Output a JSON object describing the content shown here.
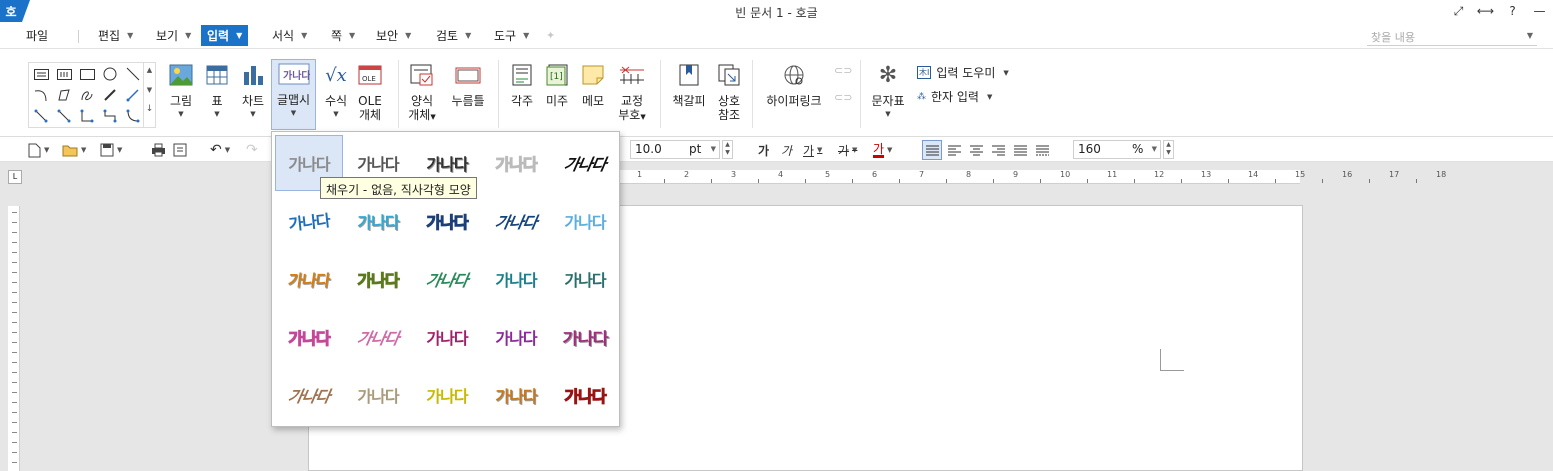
{
  "title": "빈 문서 1 - 호글",
  "app_logo": "호",
  "window_controls": [
    "⤢",
    "⟷",
    "?",
    "—"
  ],
  "menu": {
    "file": "파일",
    "items": [
      "편집",
      "보기",
      "입력",
      "서식",
      "쪽",
      "보안",
      "검토",
      "도구"
    ],
    "active": "입력",
    "search_placeholder": "찾을 내용"
  },
  "ribbon": {
    "picture": "그림",
    "table": "표",
    "chart": "차트",
    "wordart": "글맵시",
    "formula": "수식",
    "ole_line1": "OLE",
    "ole_line2": "개체",
    "form_line1": "양식",
    "form_line2": "개체",
    "pushbutton": "누름틀",
    "footnote": "각주",
    "endnote": "미주",
    "memo": "메모",
    "proof_line1": "교정",
    "proof_line2": "부호",
    "bookmark": "책갈피",
    "crossref_line1": "상호",
    "crossref_line2": "참조",
    "hyperlink": "하이퍼링크",
    "charmap": "문자표",
    "input_helper": "입력 도우미",
    "hanja_input": "한자 입력"
  },
  "toolbar": {
    "font_size": "10.0",
    "font_unit": "pt",
    "bold": "가",
    "italic": "가",
    "underline": "가",
    "strike": "가",
    "color_text": "가",
    "zoom": "160",
    "zoom_unit": "%"
  },
  "ruler": [
    "1",
    "2",
    "3",
    "4",
    "5",
    "6",
    "7",
    "8",
    "9",
    "10",
    "11",
    "12",
    "13",
    "14",
    "15",
    "16",
    "17",
    "18"
  ],
  "gallery": {
    "sample_text": "가나다",
    "tooltip": "채우기 - 없음, 직사각형 모양",
    "rows": [
      [
        {
          "c": "#8b8b8b"
        },
        {
          "c": "#555555"
        },
        {
          "c": "#333333"
        },
        {
          "c": "#bbbbbb"
        },
        {
          "c": "#111111"
        }
      ],
      [
        {
          "c": "#1e6fb8"
        },
        {
          "c": "#2eaad8"
        },
        {
          "c": "#1d3f78"
        },
        {
          "c": "#15437e"
        },
        {
          "c": "#5aaee0"
        }
      ],
      [
        {
          "c": "#d87d10"
        },
        {
          "c": "#5b7a1e"
        },
        {
          "c": "#2a8a5a"
        },
        {
          "c": "#1a7f8c"
        },
        {
          "c": "#2a6f6f"
        }
      ],
      [
        {
          "c": "#c4479a"
        },
        {
          "c": "#d06aa8"
        },
        {
          "c": "#a01f6a"
        },
        {
          "c": "#8a2a9a"
        },
        {
          "c": "#a02c7a"
        }
      ],
      [
        {
          "c": "#a0724f"
        },
        {
          "c": "#a89a7a"
        },
        {
          "c": "#c9b800"
        },
        {
          "c": "#c8781a"
        },
        {
          "c": "#9a1313"
        }
      ]
    ]
  }
}
